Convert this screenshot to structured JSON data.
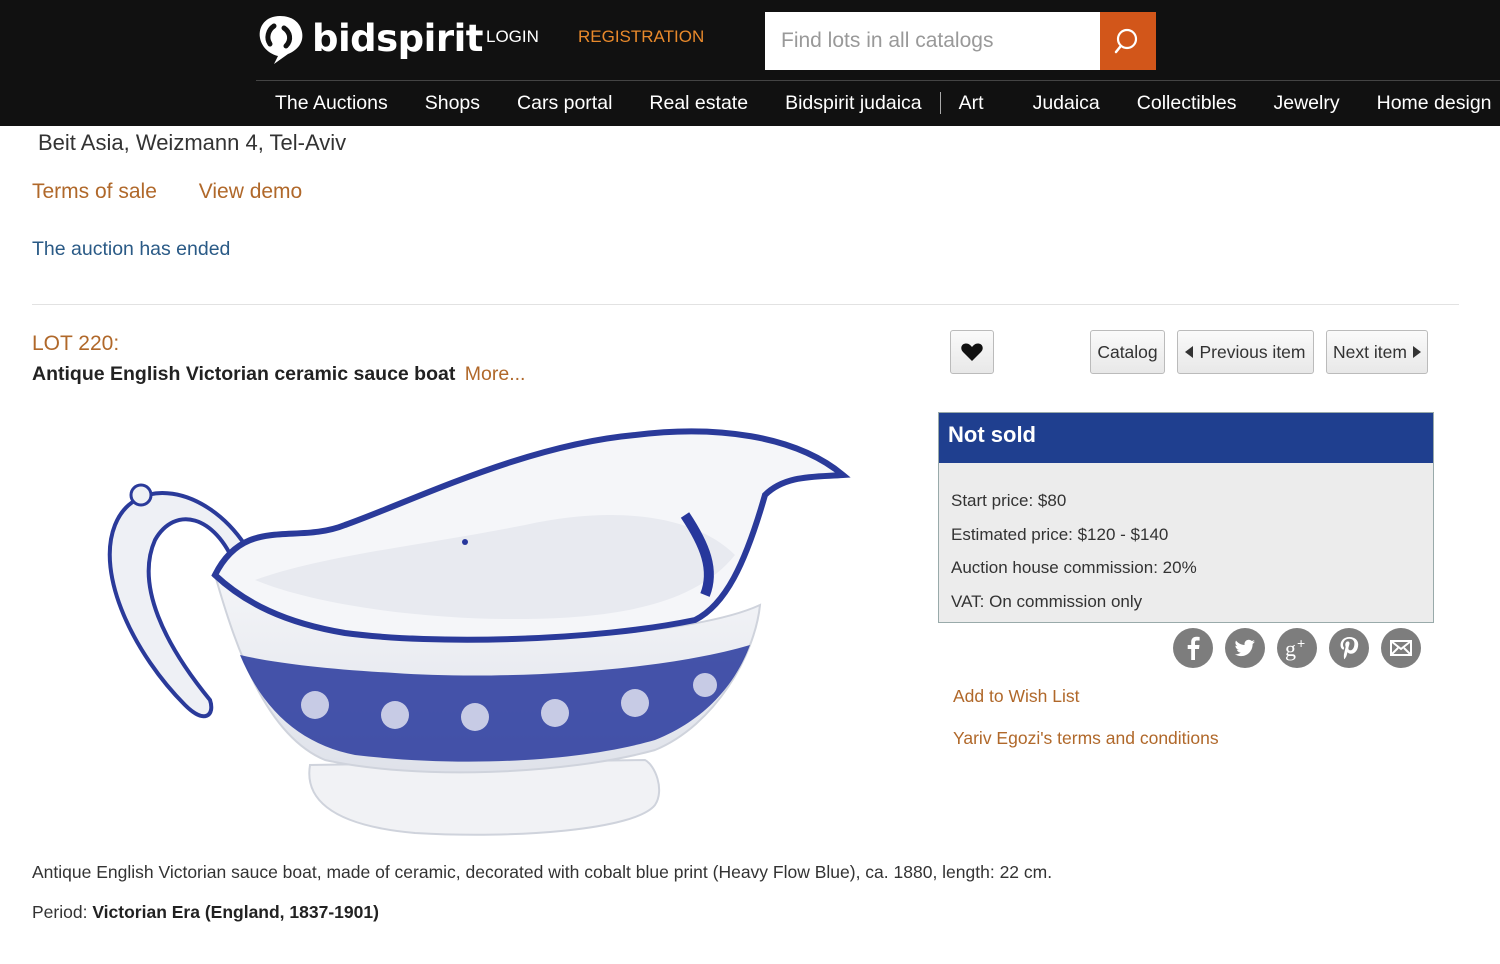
{
  "header": {
    "logo_text": "bidspirit",
    "login": "LOGIN",
    "registration": "REGISTRATION",
    "search_placeholder": "Find lots in all catalogs",
    "nav": [
      "The Auctions",
      "Shops",
      "Cars portal",
      "Real estate",
      "Bidspirit judaica",
      "Art",
      "Judaica",
      "Collectibles",
      "Jewelry",
      "Home design"
    ]
  },
  "auction": {
    "venue": "Beit Asia, Weizmann 4, Tel-Aviv",
    "terms_of_sale": "Terms of sale",
    "view_demo": "View demo",
    "status_message": "The auction has ended"
  },
  "lot": {
    "number": "LOT 220:",
    "title": "Antique English Victorian ceramic sauce boat",
    "more": "More...",
    "description": "Antique English Victorian sauce boat, made of ceramic, decorated with cobalt blue print (Heavy Flow Blue), ca. 1880, length: 22 cm.",
    "period_label": "Period:",
    "period_value": "Victorian Era (England, 1837-1901)"
  },
  "buttons": {
    "catalog": "Catalog",
    "previous": "Previous item",
    "next": "Next item"
  },
  "sale_info": {
    "status": "Not sold",
    "start_price": "Start price: $80",
    "estimated_price": "Estimated price: $120 - $140",
    "commission": "Auction house commission: 20%",
    "vat": "VAT: On commission only"
  },
  "social_icons": [
    "facebook-icon",
    "twitter-icon",
    "google-plus-icon",
    "pinterest-icon",
    "email-icon"
  ],
  "actions": {
    "wish_list": "Add to Wish List",
    "house_terms": "Yariv Egozi's terms and conditions"
  },
  "colors": {
    "topbar": "#111111",
    "accent_orange": "#d2561a",
    "link_brown": "#b0682a",
    "status_blue": "#1f3f8f"
  }
}
